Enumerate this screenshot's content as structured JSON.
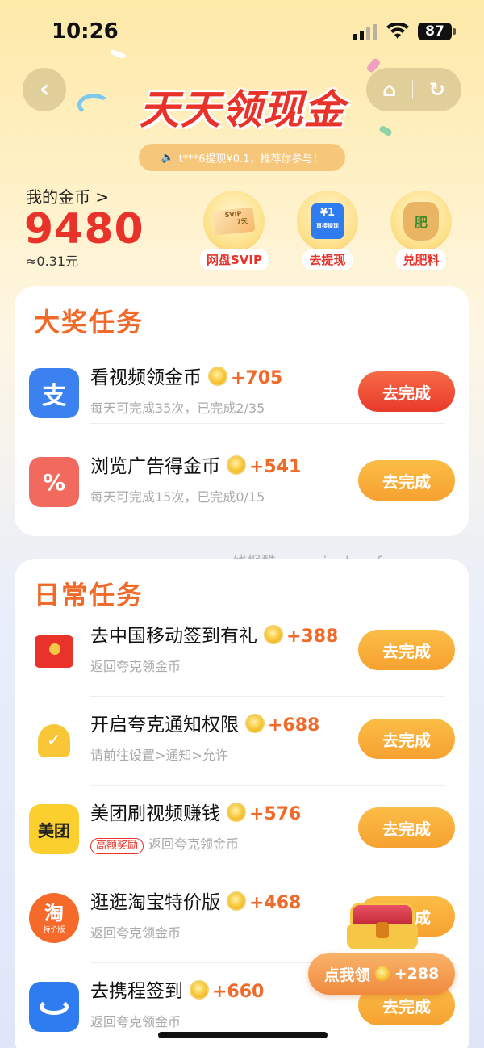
{
  "status_bar": {
    "time": "10:26",
    "battery": "87"
  },
  "header": {
    "title": "天天领现金",
    "notice": "t***6提现¥0.1，推荐你参与！"
  },
  "coins": {
    "label": "我的金币 >",
    "value": "9480",
    "approx": "≈0.31元"
  },
  "shortcuts": [
    {
      "label": "网盘SVIP",
      "icon": "svip-card-icon",
      "art": "SVIP",
      "art_sub": "7天"
    },
    {
      "label": "去提现",
      "icon": "cash-withdraw-icon",
      "art": "¥1",
      "art_sub": "直接提现"
    },
    {
      "label": "兑肥料",
      "icon": "fertilizer-sack-icon",
      "art": "肥"
    }
  ],
  "big_tasks": {
    "title": "大奖任务",
    "items": [
      {
        "name": "看视频领金币",
        "reward": "+705",
        "sub": "每天可完成35次，已完成2/35",
        "button": "去完成",
        "icon": "alipay-icon",
        "style": "red"
      },
      {
        "name": "浏览广告得金币",
        "reward": "+541",
        "sub": "每天可完成15次，已完成0/15",
        "button": "去完成",
        "icon": "shopping-bag-icon",
        "style": "orange"
      }
    ]
  },
  "daily_tasks": {
    "title": "日常任务",
    "items": [
      {
        "name": "去中国移动签到有礼",
        "reward": "+388",
        "sub": "返回夸克领金币",
        "button": "去完成",
        "icon": "red-envelope-icon"
      },
      {
        "name": "开启夸克通知权限",
        "reward": "+688",
        "sub": "请前往设置>通知>允许",
        "button": "去完成",
        "icon": "bell-icon"
      },
      {
        "name": "美团刷视频赚钱",
        "reward": "+576",
        "badge": "高额奖励",
        "sub": "返回夸克领金币",
        "button": "去完成",
        "icon": "meituan-icon",
        "icon_text": "美团"
      },
      {
        "name": "逛逛淘宝特价版",
        "reward": "+468",
        "sub": "返回夸克领金币",
        "button": "去完成",
        "icon": "taobao-icon",
        "icon_text": "淘",
        "icon_sub": "特价版"
      },
      {
        "name": "去携程签到",
        "reward": "+660",
        "sub": "返回夸克领金币",
        "button": "去完成",
        "icon": "ctrip-icon"
      }
    ]
  },
  "watermark": "线报酷-new.xianbao.fun",
  "floating": {
    "claim_label": "点我领",
    "claim_reward": "+288"
  },
  "colors": {
    "accent_red": "#e8322a",
    "accent_orange": "#f06a2a",
    "button_orange": "#f6a130"
  }
}
